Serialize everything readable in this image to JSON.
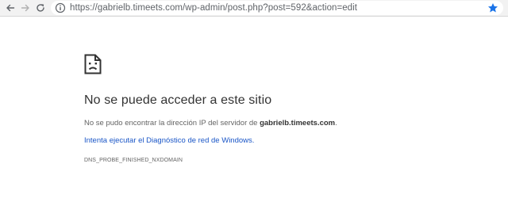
{
  "browser": {
    "url": "https://gabrielb.timeets.com/wp-admin/post.php?post=592&action=edit",
    "icons": {
      "back": "back-arrow-icon",
      "forward": "forward-arrow-icon",
      "reload": "reload-icon",
      "site_info": "info-icon",
      "bookmark": "star-icon"
    },
    "colors": {
      "bookmark_star": "#1a73e8"
    }
  },
  "error_page": {
    "icon": "sad-page-icon",
    "title": "No se puede acceder a este sitio",
    "description_prefix": "No se pudo encontrar la dirección IP del servidor de ",
    "domain": "gabrielb.timeets.com",
    "description_suffix": ".",
    "diagnostic_link": "Intenta ejecutar el Diagnóstico de red de Windows.",
    "error_code": "DNS_PROBE_FINISHED_NXDOMAIN",
    "colors": {
      "link": "#1a56c7",
      "title": "#333333"
    }
  }
}
